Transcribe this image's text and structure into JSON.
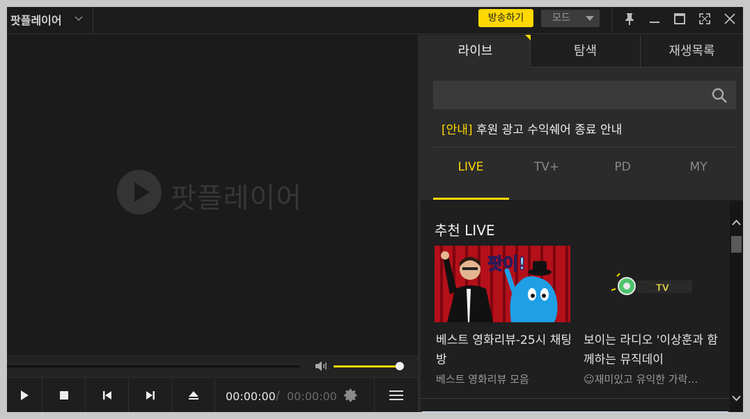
{
  "titlebar": {
    "app_name": "팟플레이어",
    "broadcast_label": "방송하기",
    "mode_label": "모드"
  },
  "player": {
    "logo_text": "팟플레이어",
    "time_current": "00:00:00",
    "time_separator": "/",
    "time_total": "00:00:00",
    "volume_fraction": 0.94
  },
  "panel": {
    "tabs": [
      {
        "label": "라이브"
      },
      {
        "label": "탐색"
      },
      {
        "label": "재생목록"
      }
    ],
    "notice_tag": "[안내]",
    "notice_text": "후원 광고 수익쉐어 종료 안내",
    "subtabs": [
      {
        "label": "LIVE"
      },
      {
        "label": "TV+"
      },
      {
        "label": "PD"
      },
      {
        "label": "MY"
      }
    ],
    "section_title": "추천 LIVE",
    "cards": [
      {
        "title": "베스트 영화리뷰-25시 채팅방",
        "subtitle": "베스트 영화리뷰 모음",
        "thumb_text": "팟이!"
      },
      {
        "title": "보이는 라디오 '이상훈과 함께하는 뮤직데이",
        "subtitle": "☺재미있고 유익한 가락…",
        "thumb_text": "가락TV"
      }
    ]
  },
  "colors": {
    "accent": "#ffd800",
    "background": "#1b1b1b",
    "panel": "#2b2b2b"
  }
}
